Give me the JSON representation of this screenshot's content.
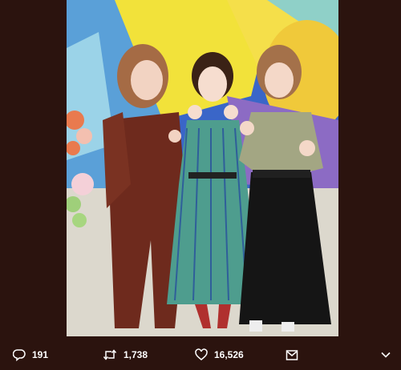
{
  "tweet": {
    "photo": {
      "alt": "Three women posing together in front of a colorful mural"
    },
    "actions": {
      "replies": "191",
      "retweets": "1,738",
      "likes": "16,526"
    },
    "icons": {
      "reply": "reply-icon",
      "retweet": "retweet-icon",
      "like": "heart-icon",
      "share": "share-icon",
      "more": "chevron-down-icon"
    }
  }
}
